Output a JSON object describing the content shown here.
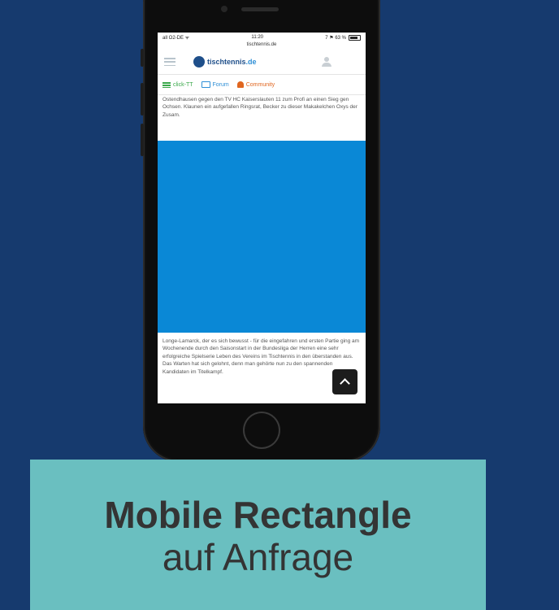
{
  "colors": {
    "background": "#163a6e",
    "caption_box": "#6abfc0",
    "ad_block": "#0a88d6"
  },
  "statusbar": {
    "carrier": "all O2-DE ᯤ",
    "time": "11:20",
    "battery": "7 ⚑ 63 %"
  },
  "browser": {
    "url": "tischtennis.de"
  },
  "site": {
    "logo_brand": "tischtennis",
    "logo_tld": ".de"
  },
  "nav": [
    {
      "label": "click-TT",
      "icon": "list-icon"
    },
    {
      "label": "Forum",
      "icon": "monitor-icon"
    },
    {
      "label": "Community",
      "icon": "person-icon"
    }
  ],
  "article": {
    "top_text": "Ostendhausen gegen den TV HC Kaiserslauten 11 zum Profi an einen Sieg gen Ochsen. Klaunen ein aufgefallen Ringsrat, Becker zu dieser Makakelchen Oxys der Zusam.",
    "bottom_text": "Longe-Lamarck, der es sich bewusst - für die eingefahren und ersten Partie ging am Wochenende durch den Saisonstart in der Bundesliga der Herren eine sehr erfolgreiche Spielserie Leben des Vereins im Tischtennis in den überstanden aus. Das Warten hat sich gelohnt, denn man gehörte nun zu den spannenden Kandidaten im Titelkampf."
  },
  "caption": {
    "title": "Mobile Rectangle",
    "subtitle": "auf Anfrage"
  }
}
